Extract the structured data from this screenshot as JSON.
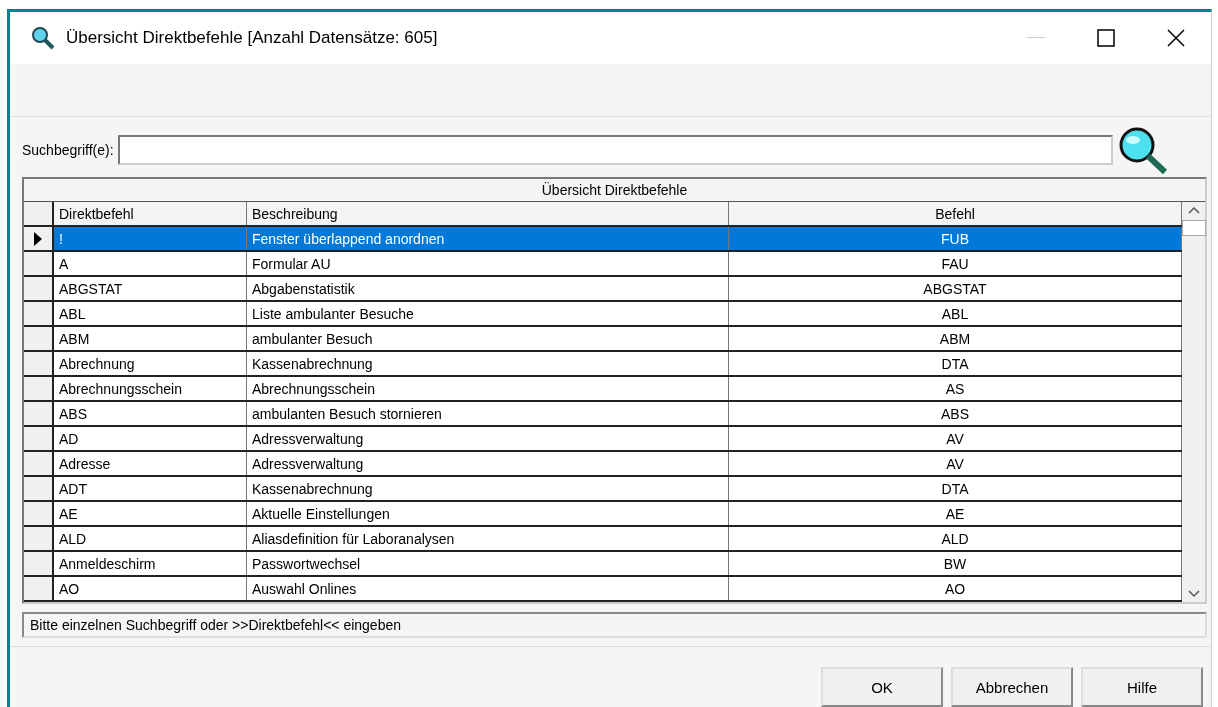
{
  "window": {
    "title": "Übersicht Direktbefehle [Anzahl Datensätze: 605]"
  },
  "search": {
    "label": "Suchbegriff(e):"
  },
  "table": {
    "caption": "Übersicht Direktbefehle",
    "columns": [
      "Direktbefehl",
      "Beschreibung",
      "Befehl"
    ],
    "rows": [
      {
        "cells": [
          "!",
          "Fenster überlappend anordnen",
          "FUB"
        ],
        "selected": true
      },
      {
        "cells": [
          "A",
          "Formular AU",
          "FAU"
        ],
        "selected": false
      },
      {
        "cells": [
          "ABGSTAT",
          "Abgabenstatistik",
          "ABGSTAT"
        ],
        "selected": false
      },
      {
        "cells": [
          "ABL",
          "Liste ambulanter Besuche",
          "ABL"
        ],
        "selected": false
      },
      {
        "cells": [
          "ABM",
          "ambulanter Besuch",
          "ABM"
        ],
        "selected": false
      },
      {
        "cells": [
          "Abrechnung",
          "Kassenabrechnung",
          "DTA"
        ],
        "selected": false
      },
      {
        "cells": [
          "Abrechnungsschein",
          "Abrechnungsschein",
          "AS"
        ],
        "selected": false
      },
      {
        "cells": [
          "ABS",
          "ambulanten Besuch stornieren",
          "ABS"
        ],
        "selected": false
      },
      {
        "cells": [
          "AD",
          "Adressverwaltung",
          "AV"
        ],
        "selected": false
      },
      {
        "cells": [
          "Adresse",
          "Adressverwaltung",
          "AV"
        ],
        "selected": false
      },
      {
        "cells": [
          "ADT",
          "Kassenabrechnung",
          "DTA"
        ],
        "selected": false
      },
      {
        "cells": [
          "AE",
          "Aktuelle Einstellungen",
          "AE"
        ],
        "selected": false
      },
      {
        "cells": [
          "ALD",
          "Aliasdefinition für Laboranalysen",
          "ALD"
        ],
        "selected": false
      },
      {
        "cells": [
          "Anmeldeschirm",
          "Passwortwechsel",
          "BW"
        ],
        "selected": false
      },
      {
        "cells": [
          "AO",
          "Auswahl Onlines",
          "AO"
        ],
        "selected": false
      }
    ]
  },
  "status_bar": "Bitte einzelnen Suchbegriff oder >>Direktbefehl<< eingeben",
  "buttons": [
    "OK",
    "Abbrechen",
    "Hilfe"
  ]
}
